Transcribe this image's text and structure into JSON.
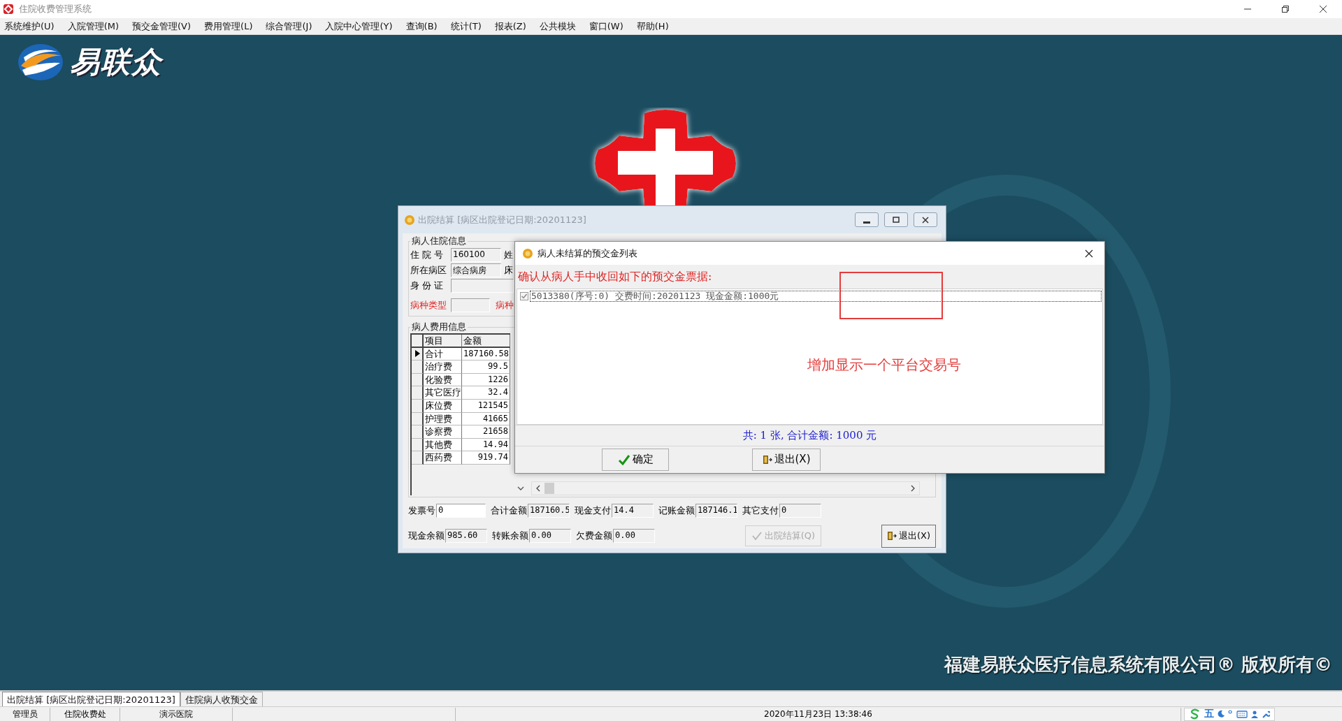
{
  "app_window": {
    "title": "住院收费管理系统"
  },
  "menu": [
    "系统维护(U)",
    "入院管理(M)",
    "预交金管理(V)",
    "费用管理(L)",
    "综合管理(J)",
    "入院中心管理(Y)",
    "查询(B)",
    "统计(T)",
    "报表(Z)",
    "公共模块",
    "窗口(W)",
    "帮助(H)"
  ],
  "desktop": {
    "logo_text": "易联众",
    "copyright": "福建易联众医疗信息系统有限公司® 版权所有©"
  },
  "settlement_dialog": {
    "title": "出院结算 [病区出院登记日期:20201123]",
    "active": false,
    "inpatient_info": {
      "legend": "病人住院信息",
      "fields": [
        {
          "label": "住 院 号",
          "value": "160100",
          "required": false,
          "side_label": "姓"
        },
        {
          "label": "所在病区",
          "value": "综合病房",
          "required": false,
          "side_label": "床"
        },
        {
          "label": "身 份 证",
          "required": false
        },
        {
          "label": "病种类型",
          "required": true,
          "side_label": "病种"
        }
      ]
    },
    "cost_info": {
      "legend": "病人费用信息",
      "columns": [
        "项目",
        "金额"
      ],
      "rows": [
        {
          "item": "合计",
          "amount": "187160.58",
          "selected": true
        },
        {
          "item": "治疗费",
          "amount": "99.5",
          "selected": false
        },
        {
          "item": "化验费",
          "amount": "1226",
          "selected": false
        },
        {
          "item": "其它医疗",
          "amount": "32.4",
          "selected": false
        },
        {
          "item": "床位费",
          "amount": "121545",
          "selected": false
        },
        {
          "item": "护理费",
          "amount": "41665",
          "selected": false
        },
        {
          "item": "诊察费",
          "amount": "21658",
          "selected": false
        },
        {
          "item": "其他费",
          "amount": "14.94",
          "selected": false
        },
        {
          "item": "西药费",
          "amount": "919.74",
          "selected": false
        }
      ]
    },
    "totals": [
      [
        {
          "label": "发票号",
          "value": "0",
          "editable": true
        },
        {
          "label": "合计金额",
          "value": "187160.5",
          "editable": false
        },
        {
          "label": "现金支付",
          "value": "14.4",
          "editable": false
        },
        {
          "label": "记账金额",
          "value": "187146.1",
          "editable": false
        },
        {
          "label": "其它支付",
          "value": "0",
          "editable": false
        }
      ],
      [
        {
          "label": "现金余额",
          "value": "985.60",
          "editable": false
        },
        {
          "label": "转账余额",
          "value": "0.00",
          "editable": false
        },
        {
          "label": "欠费金额",
          "value": "0.00",
          "editable": false
        }
      ]
    ],
    "settle_button": {
      "label": "出院结算(Q)",
      "disabled": true
    },
    "exit_button": {
      "label": "退出(X)",
      "disabled": false
    }
  },
  "deposit_dialog": {
    "title": "病人未结算的预交金列表",
    "prompt": "确认从病人手中收回如下的预交金票据:",
    "items": [
      {
        "text": "5013380(序号:0) 交费时间:20201123 现金金额:1000元",
        "checked": true
      }
    ],
    "summary": "共: 1 张, 合计金额: 1000 元",
    "buttons": [
      {
        "kind": "ok",
        "label": "确定"
      },
      {
        "kind": "exit",
        "label": "退出(X)"
      }
    ]
  },
  "annotation": {
    "note": "增加显示一个平台交易号"
  },
  "window_tabs": [
    {
      "label": "出院结算 [病区出院登记日期:20201123]",
      "selected": true
    },
    {
      "label": "住院病人收预交金",
      "selected": false
    }
  ],
  "status_bar": {
    "cells": [
      "管理员",
      "住院收费处",
      "演示医院"
    ],
    "datetime": "2020年11月23日 13:38:46",
    "ime_mode": "五"
  }
}
